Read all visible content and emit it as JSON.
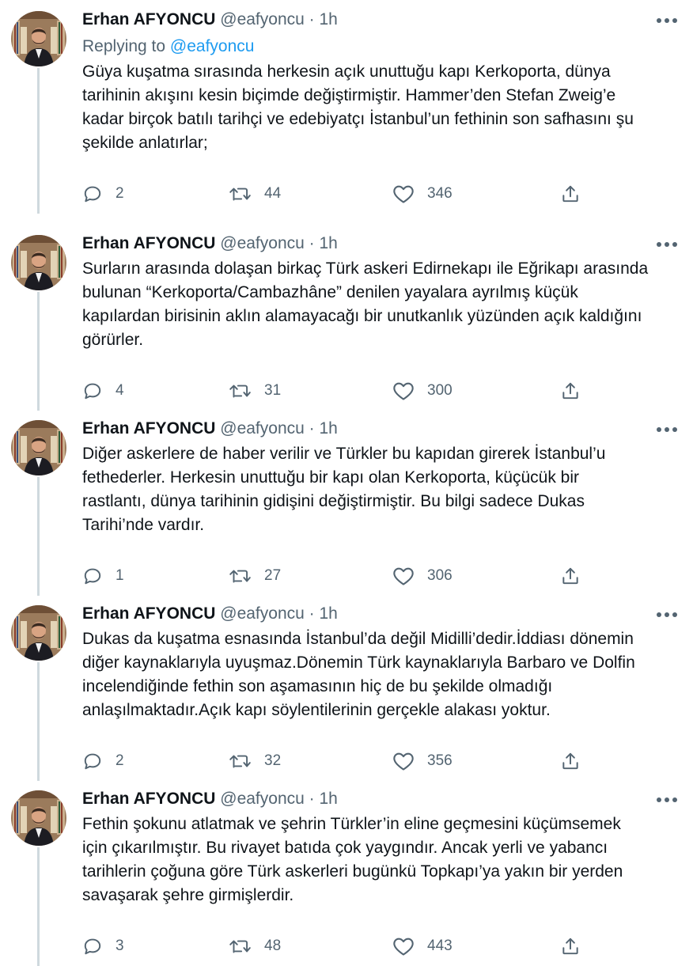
{
  "colors": {
    "text": "#0f1419",
    "secondary": "#536471",
    "link": "#1d9bf0",
    "thread_line": "#cfd9de"
  },
  "icons": {
    "reply": "reply-icon",
    "retweet": "retweet-icon",
    "like": "heart-icon",
    "share": "share-icon",
    "more": "more-dots-icon"
  },
  "tweets": [
    {
      "author_name": "Erhan AFYONCU",
      "handle": "@eafyoncu",
      "dot": "·",
      "time": "1h",
      "replying_prefix": "Replying to",
      "replying_mention": "@eafyoncu",
      "lines": [
        "Güya kuşatma sırasında herkesin açık unuttuğu kapı Kerkoporta, dünya",
        "tarihinin akışını kesin biçimde değiştirmiştir. Hammer’den Stefan Zweig’e",
        "kadar birçok batılı tarihçi ve edebiyatçı İstanbul’un fethinin son safhasını şu",
        "şekilde anlatırlar;"
      ],
      "replies": "2",
      "retweets": "44",
      "likes": "346"
    },
    {
      "author_name": "Erhan AFYONCU",
      "handle": "@eafyoncu",
      "dot": "·",
      "time": "1h",
      "lines": [
        "Surların arasında dolaşan birkaç Türk askeri Edirnekapı ile Eğrikapı arasında",
        "bulunan “Kerkoporta/Cambazhâne” denilen yayalara ayrılmış küçük",
        "kapılardan birisinin aklın alamayacağı bir unutkanlık yüzünden açık kaldığını",
        "görürler."
      ],
      "replies": "4",
      "retweets": "31",
      "likes": "300"
    },
    {
      "author_name": "Erhan AFYONCU",
      "handle": "@eafyoncu",
      "dot": "·",
      "time": "1h",
      "lines": [
        "Diğer askerlere de haber verilir ve Türkler bu kapıdan girerek İstanbul’u",
        "fethederler. Herkesin unuttuğu bir kapı olan Kerkoporta, küçücük bir",
        "rastlantı, dünya tarihinin gidişini değiştirmiştir. Bu bilgi sadece Dukas",
        "Tarihi’nde vardır."
      ],
      "replies": "1",
      "retweets": "27",
      "likes": "306"
    },
    {
      "author_name": "Erhan AFYONCU",
      "handle": "@eafyoncu",
      "dot": "·",
      "time": "1h",
      "lines": [
        "Dukas da kuşatma esnasında İstanbul’da değil Midilli’dedir.İddiası dönemin",
        "diğer kaynaklarıyla uyuşmaz.Dönemin Türk kaynaklarıyla Barbaro ve Dolfin",
        "incelendiğinde fethin son aşamasının hiç de bu şekilde olmadığı",
        "anlaşılmaktadır.Açık kapı söylentilerinin gerçekle alakası yoktur."
      ],
      "replies": "2",
      "retweets": "32",
      "likes": "356"
    },
    {
      "author_name": "Erhan AFYONCU",
      "handle": "@eafyoncu",
      "dot": "·",
      "time": "1h",
      "lines": [
        "Fethin şokunu atlatmak ve şehrin Türkler’in eline geçmesini küçümsemek",
        "için çıkarılmıştır. Bu rivayet batıda çok yaygındır. Ancak yerli ve yabancı",
        "tarihlerin çoğuna göre Türk askerleri bugünkü Topkapı’ya yakın bir yerden",
        "savaşarak şehre girmişlerdir."
      ],
      "replies": "3",
      "retweets": "48",
      "likes": "443"
    }
  ]
}
